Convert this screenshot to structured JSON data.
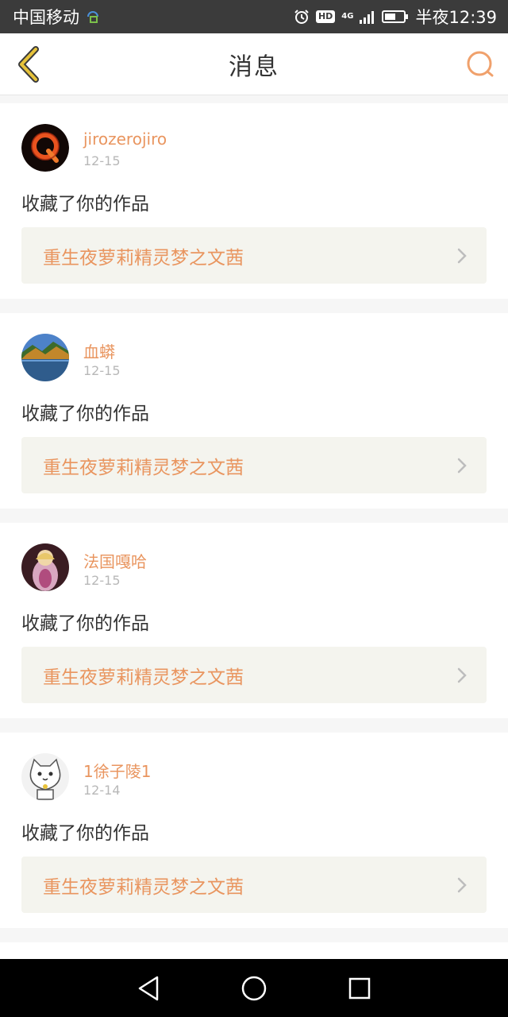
{
  "status_bar": {
    "carrier": "中国移动",
    "network": "4G",
    "hd": "HD",
    "time": "半夜12:39"
  },
  "header": {
    "title": "消息",
    "back_icon": "chevron-left-icon",
    "search_icon": "search-icon"
  },
  "colors": {
    "accent": "#e9955f",
    "back_chevron": "#c9a227",
    "card_link_bg": "#f4f4ee"
  },
  "messages": [
    {
      "user": "jirozerojiro",
      "date": "12-15",
      "text": "收藏了你的作品",
      "work": "重生夜萝莉精灵梦之文茜"
    },
    {
      "user": "血蟒",
      "date": "12-15",
      "text": "收藏了你的作品",
      "work": "重生夜萝莉精灵梦之文茜"
    },
    {
      "user": "法国嘎哈",
      "date": "12-15",
      "text": "收藏了你的作品",
      "work": "重生夜萝莉精灵梦之文茜"
    },
    {
      "user": "1徐子陵1",
      "date": "12-14",
      "text": "收藏了你的作品",
      "work": "重生夜萝莉精灵梦之文茜"
    }
  ],
  "nav": {
    "back": "nav-back-icon",
    "home": "nav-home-icon",
    "recents": "nav-recents-icon"
  }
}
